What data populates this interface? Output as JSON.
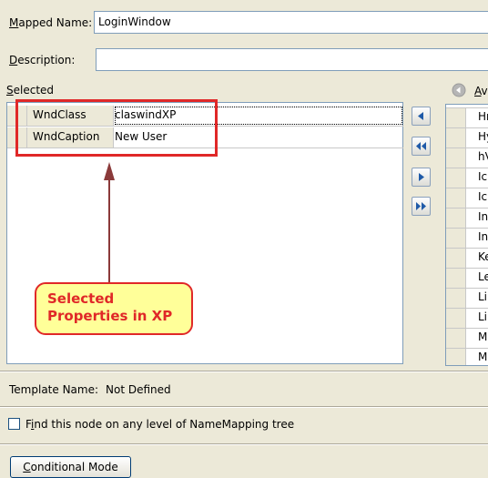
{
  "mapped_name": {
    "label_key": "M",
    "label_rest": "apped Name:",
    "value": "LoginWindow"
  },
  "description": {
    "label_key": "D",
    "label_rest": "escription:",
    "value": ""
  },
  "selected": {
    "heading_key": "S",
    "heading_rest": "elected",
    "properties": [
      {
        "name": "WndClass",
        "value": "claswindXP"
      },
      {
        "name": "WndCaption",
        "value": "New User"
      }
    ]
  },
  "available": {
    "heading_key": "A",
    "heading_rest": "v",
    "items": [
      "Hr",
      "Hy",
      "hV",
      "Ic",
      "Ic",
      "In",
      "In",
      "Ke",
      "Le",
      "Lin",
      "Lin",
      "M",
      "M"
    ]
  },
  "annotation": {
    "line1": "Selected",
    "line2": "Properties in XP"
  },
  "template": {
    "label": "Template Name:",
    "value": "Not Defined"
  },
  "find_node": {
    "key": "i",
    "prefix": "F",
    "rest": "nd this node on any level of NameMapping tree",
    "checked": false
  },
  "conditional_mode": {
    "key": "C",
    "rest": "onditional Mode"
  },
  "colors": {
    "highlight": "#e02828",
    "callout_fill": "#ffff99",
    "arrow": "#8b3a3a",
    "button_arrow": "#1f5aa8"
  }
}
